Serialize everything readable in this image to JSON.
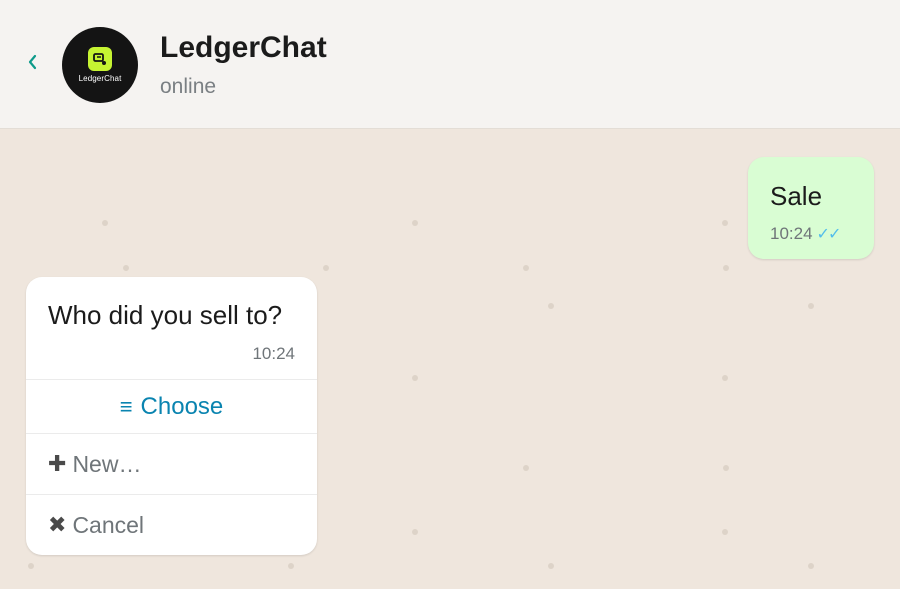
{
  "header": {
    "title": "LedgerChat",
    "status": "online",
    "avatar_text": "LedgerChat",
    "back_icon": "chevron-left-icon"
  },
  "colors": {
    "accent": "#0d9a8a",
    "logo_green": "#c6f432",
    "outgoing_bubble": "#d9fdd3",
    "link_blue": "#0a84b0",
    "read_ticks": "#53bdeb"
  },
  "messages": {
    "outgoing": {
      "text": "Sale",
      "time": "10:24",
      "ticks": "✓✓"
    },
    "incoming": {
      "text": "Who did you sell to?",
      "time": "10:24",
      "choose_label": "Choose",
      "choose_icon": "≡",
      "options": [
        {
          "icon": "✚",
          "label": "New…"
        },
        {
          "icon": "✖",
          "label": "Cancel"
        }
      ]
    }
  }
}
